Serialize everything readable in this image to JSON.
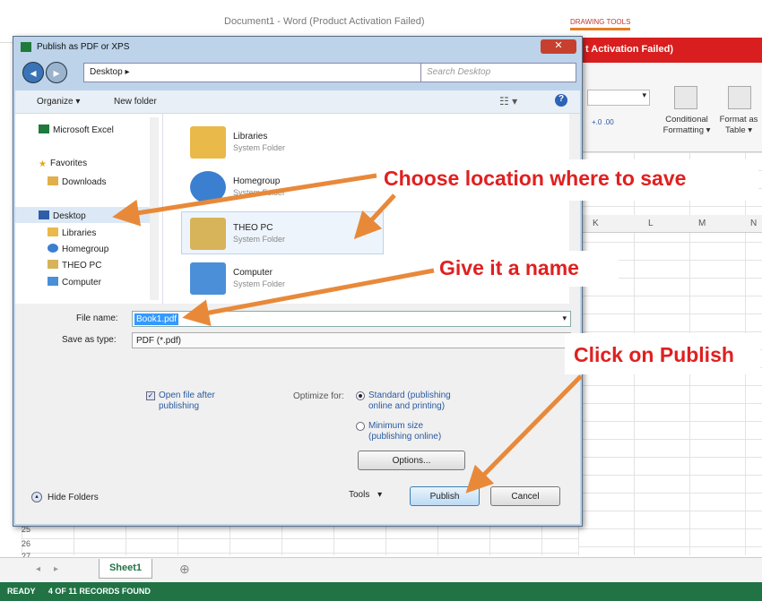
{
  "background": {
    "word_title": "Document1 - Word (Product Activation Failed)",
    "drawing_tools": "DRAWING TOOLS",
    "activation_banner": "t Activation Failed)",
    "ribbon": {
      "conditional_formatting": "Conditional Formatting ▾",
      "format_as_table": "Format as Table ▾",
      "number_format_glyphs": "+.0 .00"
    },
    "columns": [
      "K",
      "L",
      "M",
      "N"
    ],
    "row_numbers": [
      "25",
      "26",
      "27"
    ],
    "sheet_tab": "Sheet1",
    "status_ready": "READY",
    "status_records": "4 OF 11 RECORDS FOUND"
  },
  "dialog": {
    "title": "Publish as PDF or XPS",
    "address": "Desktop ▸",
    "search_placeholder": "Search Desktop",
    "toolbar": {
      "organize": "Organize ▾",
      "new_folder": "New folder"
    },
    "nav_items": [
      {
        "label": "Microsoft Excel",
        "icon": "excel-icon"
      },
      {
        "label": "Favorites",
        "icon": "star-icon"
      },
      {
        "label": "Downloads",
        "icon": "folder-icon"
      },
      {
        "label": "Desktop",
        "icon": "desktop-icon"
      },
      {
        "label": "Libraries",
        "icon": "libraries-icon"
      },
      {
        "label": "Homegroup",
        "icon": "homegroup-icon"
      },
      {
        "label": "THEO PC",
        "icon": "computer-icon"
      },
      {
        "label": "Computer",
        "icon": "computer-icon"
      }
    ],
    "folders": [
      {
        "name": "Libraries",
        "type": "System Folder",
        "color": "#e9b949"
      },
      {
        "name": "Homegroup",
        "type": "System Folder",
        "color": "#3a7fd0"
      },
      {
        "name": "THEO PC",
        "type": "System Folder",
        "color": "#d7b35a"
      },
      {
        "name": "Computer",
        "type": "System Folder",
        "color": "#4a8fd8"
      }
    ],
    "file_name_label": "File name:",
    "file_name_value": "Book1.pdf",
    "save_type_label": "Save as type:",
    "save_type_value": "PDF (*.pdf)",
    "open_after": "Open file after publishing",
    "optimize_label": "Optimize for:",
    "opt_standard": "Standard (publishing online and printing)",
    "opt_minimum": "Minimum size (publishing online)",
    "options_button": "Options...",
    "hide_folders": "Hide Folders",
    "tools": "Tools",
    "publish": "Publish",
    "cancel": "Cancel"
  },
  "callouts": {
    "location": "Choose location where to save",
    "name": "Give it a name",
    "publish": "Click on Publish",
    "color": "#e02020",
    "arrow_color": "#e8893a"
  }
}
